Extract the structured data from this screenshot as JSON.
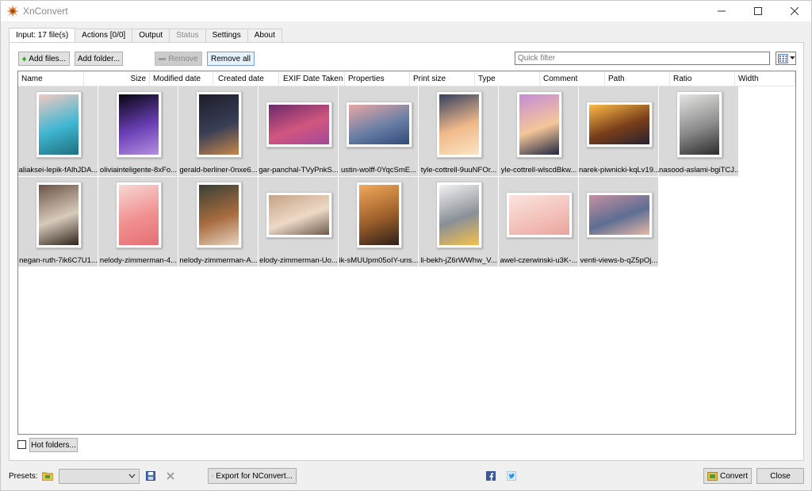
{
  "window": {
    "title": "XnConvert"
  },
  "tabs": [
    {
      "label": "Input: 17 file(s)",
      "state": "active"
    },
    {
      "label": "Actions [0/0]",
      "state": "normal"
    },
    {
      "label": "Output",
      "state": "normal"
    },
    {
      "label": "Status",
      "state": "disabled"
    },
    {
      "label": "Settings",
      "state": "normal"
    },
    {
      "label": "About",
      "state": "normal"
    }
  ],
  "toolbar": {
    "add_files": "Add files...",
    "add_folder": "Add folder...",
    "remove": "Remove",
    "remove_all": "Remove all",
    "filter_placeholder": "Quick filter"
  },
  "columns": [
    "Name",
    "Size",
    "Modified date",
    "Created date",
    "EXIF Date Taken",
    "Properties",
    "Print size",
    "Type",
    "Comment",
    "Path",
    "Ratio",
    "Width"
  ],
  "files": [
    {
      "name": "aliaksei-lepik-fAlhJDA...",
      "orientation": "portrait",
      "palette": [
        "#f2c9c0",
        "#3fb6d2",
        "#1f6f7d"
      ]
    },
    {
      "name": "oliviainteligente-8xFo...",
      "orientation": "portrait",
      "palette": [
        "#070612",
        "#6a3fb5",
        "#b58fe0"
      ]
    },
    {
      "name": "gerald-berliner-0nxe6...",
      "orientation": "portrait",
      "palette": [
        "#1c1d2a",
        "#3a3f57",
        "#c7884a"
      ]
    },
    {
      "name": "gar-panchal-TVyPnkS...",
      "orientation": "landscape",
      "palette": [
        "#6c2a6b",
        "#d1567f",
        "#a3489a"
      ]
    },
    {
      "name": "ustin-wolff-0YqcSmE...",
      "orientation": "landscape",
      "palette": [
        "#e8a7a3",
        "#6a7fa6",
        "#2f4a78"
      ]
    },
    {
      "name": "tyle-cottrell-9uuNFOr...",
      "orientation": "portrait",
      "palette": [
        "#33405e",
        "#f0b98a",
        "#fbe5c5"
      ]
    },
    {
      "name": "yle-cottrell-wlscdBkw...",
      "orientation": "portrait",
      "palette": [
        "#c58bd6",
        "#f5c69a",
        "#1e2740"
      ]
    },
    {
      "name": "narek-piwnicki-kqLv19...",
      "orientation": "landscape",
      "palette": [
        "#fdbb47",
        "#7a3f1a",
        "#262130"
      ]
    },
    {
      "name": "nasood-aslami-bgiTCJ...",
      "orientation": "portrait",
      "palette": [
        "#e4e4e2",
        "#8b8b8b",
        "#2b2b2b"
      ]
    },
    {
      "name": "negan-ruth-7ik6C7U1...",
      "orientation": "portrait",
      "palette": [
        "#6b5346",
        "#d8cbbb",
        "#2f241d"
      ]
    },
    {
      "name": "nelody-zimmerman-4...",
      "orientation": "portrait",
      "palette": [
        "#f6d8d4",
        "#f08f8f",
        "#e56f74"
      ]
    },
    {
      "name": "nelody-zimmerman-A...",
      "orientation": "portrait",
      "palette": [
        "#394036",
        "#a86b3e",
        "#e6d2bf"
      ]
    },
    {
      "name": "elody-zimmerman-Uo...",
      "orientation": "landscape",
      "palette": [
        "#c4a384",
        "#edd9c7",
        "#6e5a4c"
      ]
    },
    {
      "name": "ik-sMUUpm05oIY-uns...",
      "orientation": "portrait",
      "palette": [
        "#f4a85a",
        "#9c5f2a",
        "#2d1f1a"
      ]
    },
    {
      "name": "li-bekh-jZ6rWWhw_V...",
      "orientation": "portrait",
      "palette": [
        "#f2f2f2",
        "#8a8f97",
        "#f5c04b"
      ]
    },
    {
      "name": "awel-czerwinski-u3K-...",
      "orientation": "landscape",
      "palette": [
        "#fbe3df",
        "#f3c2bb",
        "#e9a49b"
      ]
    },
    {
      "name": "venti-views-b-qZ5pOj...",
      "orientation": "landscape",
      "palette": [
        "#c58fa0",
        "#5d6e93",
        "#e7b8a6"
      ]
    }
  ],
  "hot_folders": {
    "label": "Hot folders...",
    "checked": false
  },
  "bottom": {
    "presets_label": "Presets:",
    "preset_value": "",
    "export_label": "Export for NConvert...",
    "convert_label": "Convert",
    "close_label": "Close"
  }
}
